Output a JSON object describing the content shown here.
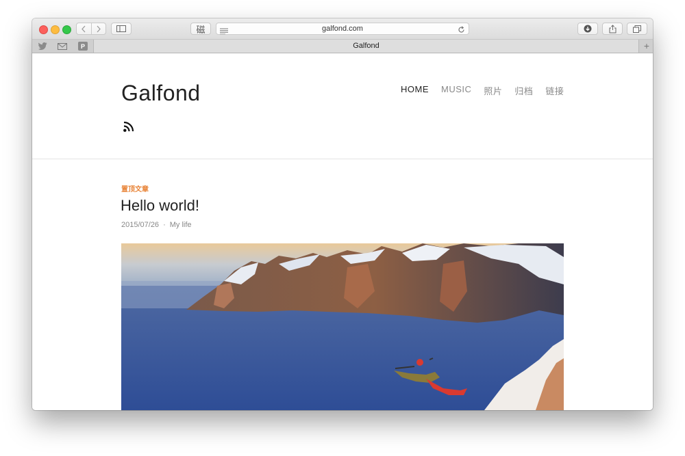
{
  "browser": {
    "address_bar": {
      "url": "galfond.com"
    },
    "toolbar": {
      "kanji_label": "磁"
    },
    "favorites": {
      "p_label": "P"
    },
    "tab": {
      "title": "Galfond"
    },
    "new_tab_label": "+"
  },
  "site": {
    "title": "Galfond",
    "nav": [
      {
        "label": "HOME",
        "active": true
      },
      {
        "label": "MUSIC"
      },
      {
        "label": "照片"
      },
      {
        "label": "归档"
      },
      {
        "label": "链接"
      }
    ]
  },
  "post": {
    "pinned_label": "置顶文章",
    "title": "Hello world!",
    "date": "2015/07/26",
    "separator": "·",
    "category": "My life"
  },
  "colors": {
    "accent": "#e8853a",
    "text": "#222222",
    "muted": "#888888"
  }
}
